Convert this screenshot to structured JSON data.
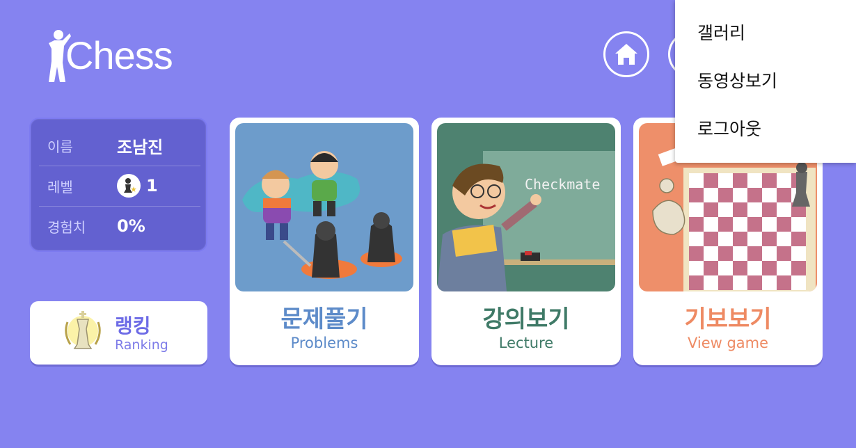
{
  "app": {
    "logo_text": "Chess"
  },
  "header": {
    "home_label": "home"
  },
  "profile": {
    "name_label": "이름",
    "name_value": "조남진",
    "level_label": "레벨",
    "level_value": "1",
    "exp_label": "경험치",
    "exp_value": "0%"
  },
  "ranking": {
    "label_ko": "랭킹",
    "label_en": "Ranking"
  },
  "cards": [
    {
      "label_ko": "문제풀기",
      "label_en": "Problems",
      "color": "#5d8bc9"
    },
    {
      "label_ko": "강의보기",
      "label_en": "Lecture",
      "color": "#3f7a67",
      "board_text": "Checkmate"
    },
    {
      "label_ko": "기보보기",
      "label_en": "View game",
      "color": "#ee8a63"
    }
  ],
  "menu": {
    "items": [
      "갤러리",
      "동영상보기",
      "로그아웃"
    ]
  },
  "colors": {
    "background": "#8583f0",
    "profile_panel": "#6361d0",
    "ranking_text": "#6d6be6"
  }
}
